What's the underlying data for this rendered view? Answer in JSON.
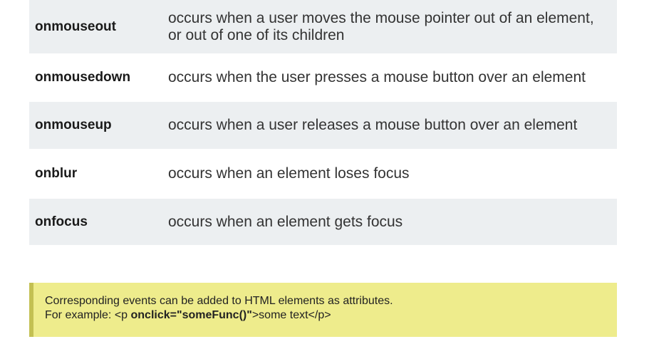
{
  "events": [
    {
      "name": "onmouseout",
      "description": "occurs when a user moves the mouse pointer out of an element, or out of one of its children"
    },
    {
      "name": "onmousedown",
      "description": "occurs when the user presses a mouse button over an element"
    },
    {
      "name": "onmouseup",
      "description": "occurs when a user releases a mouse button over an element"
    },
    {
      "name": "onblur",
      "description": "occurs when an element loses focus"
    },
    {
      "name": "onfocus",
      "description": "occurs when an element gets focus"
    }
  ],
  "note": {
    "line1": "Corresponding events can be added to HTML elements as attributes.",
    "line2_prefix": "For example: <p ",
    "line2_code": "onclick=\"someFunc()\"",
    "line2_suffix": ">some text</p>"
  },
  "colors": {
    "row_shade": "#eceff1",
    "note_background": "#eeec8c",
    "note_border": "#c3c052"
  }
}
